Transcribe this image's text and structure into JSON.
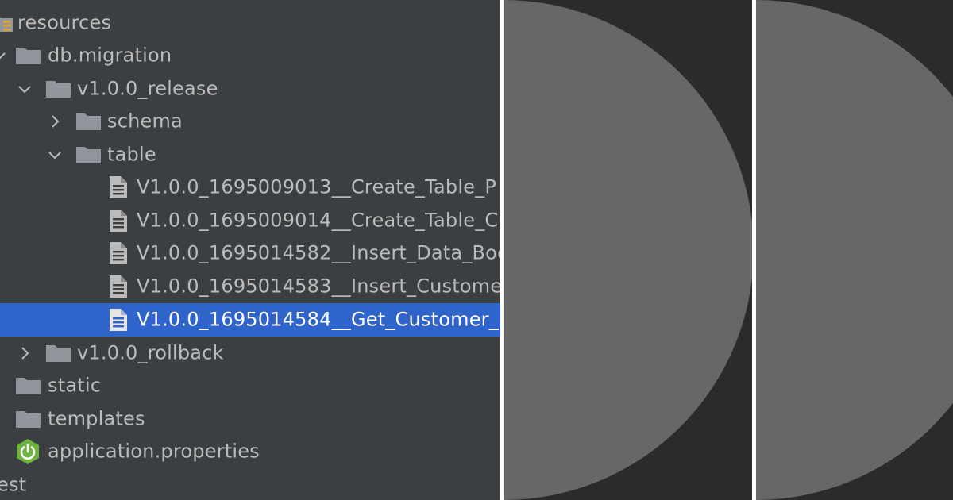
{
  "tree": {
    "items": [
      {
        "label": "resources",
        "icon": "resources-folder-icon",
        "chevron": "down"
      },
      {
        "label": "db.migration",
        "icon": "folder-icon",
        "chevron": "down"
      },
      {
        "label": "v1.0.0_release",
        "icon": "folder-icon",
        "chevron": "down"
      },
      {
        "label": "schema",
        "icon": "folder-icon",
        "chevron": "right"
      },
      {
        "label": "table",
        "icon": "folder-icon",
        "chevron": "down"
      },
      {
        "label": "V1.0.0_1695009013__Create_Table_P",
        "icon": "sql-file-icon",
        "chevron": "none"
      },
      {
        "label": "V1.0.0_1695009014__Create_Table_C",
        "icon": "sql-file-icon",
        "chevron": "none"
      },
      {
        "label": "V1.0.0_1695014582__Insert_Data_Boo",
        "icon": "sql-file-icon",
        "chevron": "none"
      },
      {
        "label": "V1.0.0_1695014583__Insert_Custome",
        "icon": "sql-file-icon",
        "chevron": "none"
      },
      {
        "label": "V1.0.0_1695014584__Get_Customer_",
        "icon": "sql-file-icon",
        "chevron": "none",
        "selected": true
      },
      {
        "label": "v1.0.0_rollback",
        "icon": "folder-icon",
        "chevron": "right"
      },
      {
        "label": "static",
        "icon": "folder-icon",
        "chevron": "none"
      },
      {
        "label": "templates",
        "icon": "folder-icon",
        "chevron": "none"
      },
      {
        "label": "application.properties",
        "icon": "spring-boot-icon",
        "chevron": "none"
      },
      {
        "label": "est",
        "icon": "none",
        "chevron": "none"
      }
    ]
  },
  "colors": {
    "tree_background": "#3c3f41",
    "text": "#bbbbbb",
    "selection": "#2f65ca",
    "folder": "#90969c",
    "panel_background": "#2b2b2b",
    "half_circle": "#676767",
    "spring_green": "#6db33f"
  }
}
